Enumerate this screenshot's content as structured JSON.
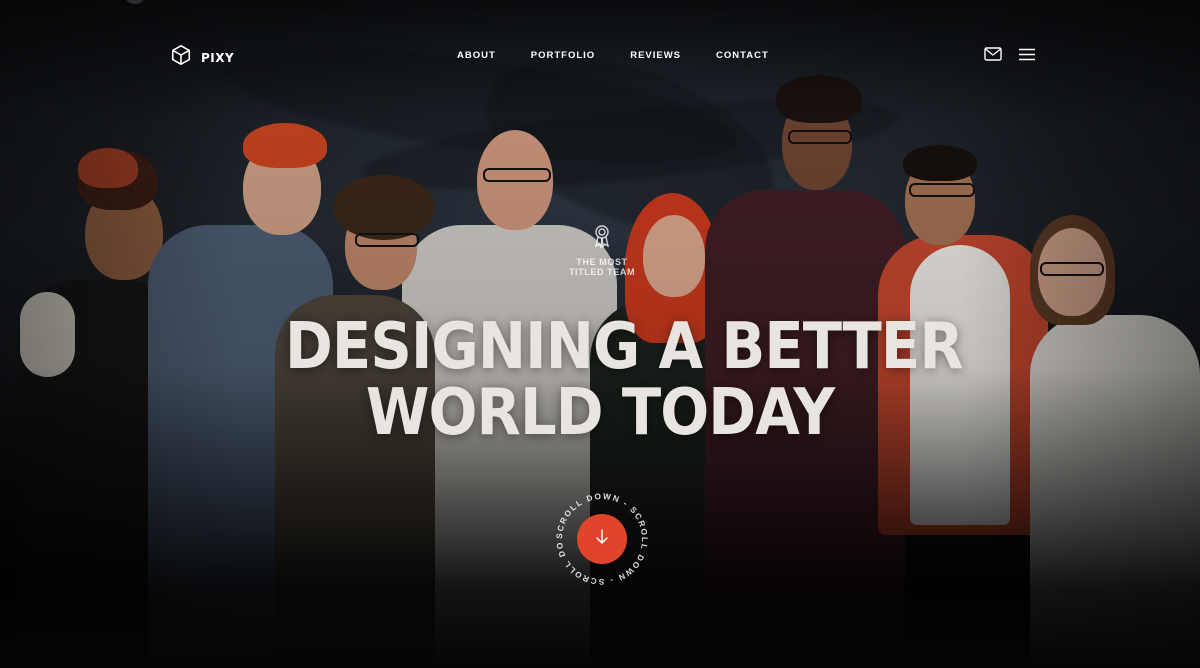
{
  "brand": {
    "name": "PIXY"
  },
  "nav": {
    "items": [
      {
        "label": "ABOUT"
      },
      {
        "label": "PORTFOLIO"
      },
      {
        "label": "REVIEWS"
      },
      {
        "label": "CONTACT"
      }
    ],
    "icons": [
      "mail-icon",
      "hamburger-menu-icon"
    ]
  },
  "award": {
    "line1": "THE MOST",
    "line2": "TITLED TEAM",
    "icon": "award-ribbon-icon"
  },
  "hero": {
    "headline_line1": "DESIGNING A BETTER",
    "headline_line2": "WORLD TODAY"
  },
  "scroll": {
    "label": "SCROLL DOWN - SCROLL DOWN - SCROLL DOWN - ",
    "icon": "arrow-down-icon"
  },
  "colors": {
    "accent": "#e0452b",
    "background": "#0b0c0e",
    "headline": "#e8e4df"
  }
}
